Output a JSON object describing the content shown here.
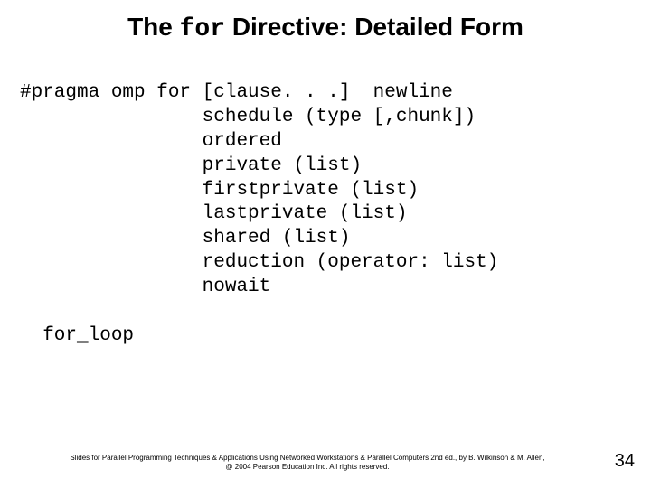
{
  "title": {
    "prefix": "The ",
    "mono": "for",
    "suffix": " Directive: Detailed Form"
  },
  "code": {
    "line1": "#pragma omp for [clause. . .]  newline",
    "line2": "                schedule (type [,chunk])",
    "line3": "                ordered",
    "line4": "                private (list)",
    "line5": "                firstprivate (list)",
    "line6": "                lastprivate (list)",
    "line7": "                shared (list)",
    "line8": "                reduction (operator: list)",
    "line9": "                nowait",
    "line10": "",
    "line11": "  for_loop"
  },
  "footer": {
    "line1": "Slides for Parallel Programming Techniques & Applications Using Networked Workstations & Parallel Computers 2nd ed., by B. Wilkinson & M. Allen,",
    "line2": "@ 2004 Pearson Education Inc. All rights reserved."
  },
  "page_number": "34"
}
